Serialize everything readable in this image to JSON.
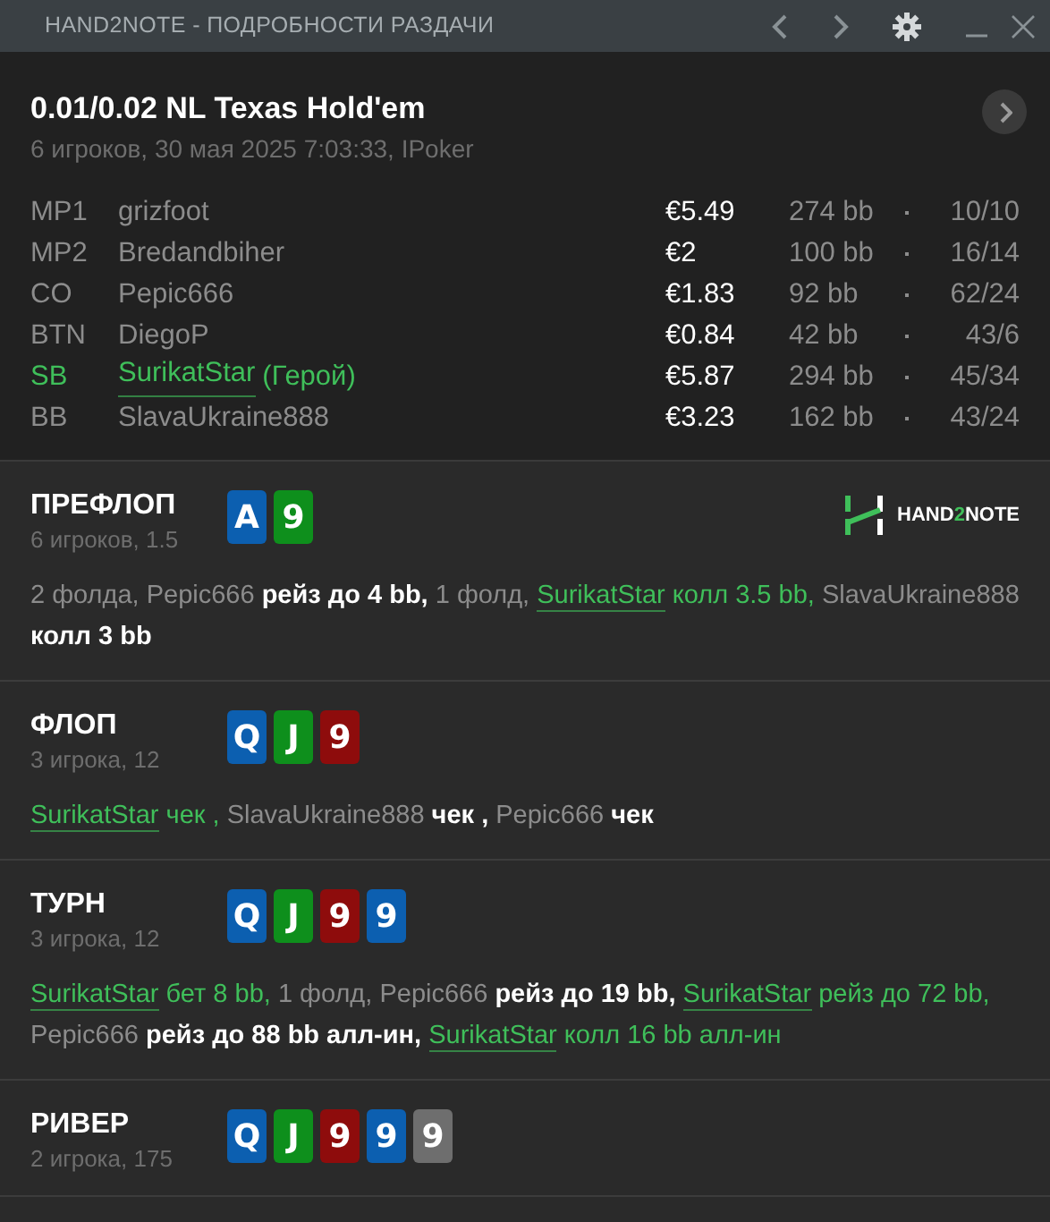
{
  "window": {
    "title": "HAND2NOTE - ПОДРОБНОСТИ РАЗДАЧИ"
  },
  "hand": {
    "title": "0.01/0.02 NL Texas Hold'em",
    "subtitle": "6 игроков, 30 мая 2025 7:03:33, IPoker"
  },
  "players": [
    {
      "position": "MP1",
      "name": "grizfoot",
      "hero": false,
      "stack": "€5.49",
      "bb": "274 bb",
      "stats": "10/10"
    },
    {
      "position": "MP2",
      "name": "Bredandbiher",
      "hero": false,
      "stack": "€2",
      "bb": "100 bb",
      "stats": "16/14"
    },
    {
      "position": "CO",
      "name": "Pepic666",
      "hero": false,
      "stack": "€1.83",
      "bb": "92 bb",
      "stats": "62/24"
    },
    {
      "position": "BTN",
      "name": "DiegoP",
      "hero": false,
      "stack": "€0.84",
      "bb": "42 bb",
      "stats": "43/6"
    },
    {
      "position": "SB",
      "name": "SurikatStar",
      "hero": true,
      "hero_label": "(Герой)",
      "stack": "€5.87",
      "bb": "294 bb",
      "stats": "45/34"
    },
    {
      "position": "BB",
      "name": "SlavaUkraine888",
      "hero": false,
      "stack": "€3.23",
      "bb": "162 bb",
      "stats": "43/24"
    }
  ],
  "logo": {
    "text": "HAND",
    "accent": "2",
    "rest": "NOTE"
  },
  "streets": [
    {
      "name": "ПРЕФЛОП",
      "info": "6 игроков, 1.5",
      "cards": [
        {
          "rank": "A",
          "color": "#0c5fb0"
        },
        {
          "rank": "9",
          "color": "#0e8f1c"
        }
      ],
      "actions": [
        {
          "kind": "fold",
          "text": "2 фолда,"
        },
        {
          "kind": "player",
          "text": "Pepic666",
          "hero": false
        },
        {
          "kind": "action",
          "text": "рейз до 4 bb,",
          "hero": false
        },
        {
          "kind": "fold",
          "text": "1 фолд,"
        },
        {
          "kind": "player",
          "text": "SurikatStar",
          "hero": true
        },
        {
          "kind": "action",
          "text": "колл 3.5 bb,",
          "hero": true
        },
        {
          "kind": "player",
          "text": "SlavaUkraine888",
          "hero": false
        },
        {
          "kind": "action",
          "text": "колл 3 bb",
          "hero": false
        }
      ]
    },
    {
      "name": "ФЛОП",
      "info": "3 игрока, 12",
      "cards": [
        {
          "rank": "Q",
          "color": "#0c5fb0"
        },
        {
          "rank": "J",
          "color": "#0e8f1c"
        },
        {
          "rank": "9",
          "color": "#8e0c0c"
        }
      ],
      "actions": [
        {
          "kind": "player",
          "text": "SurikatStar",
          "hero": true
        },
        {
          "kind": "action",
          "text": "чек ,",
          "hero": true
        },
        {
          "kind": "player",
          "text": "SlavaUkraine888",
          "hero": false
        },
        {
          "kind": "action",
          "text": "чек ,",
          "hero": false
        },
        {
          "kind": "player",
          "text": "Pepic666",
          "hero": false
        },
        {
          "kind": "action",
          "text": "чек",
          "hero": false
        }
      ]
    },
    {
      "name": "ТУРН",
      "info": "3 игрока, 12",
      "cards": [
        {
          "rank": "Q",
          "color": "#0c5fb0"
        },
        {
          "rank": "J",
          "color": "#0e8f1c"
        },
        {
          "rank": "9",
          "color": "#8e0c0c"
        },
        {
          "rank": "9",
          "color": "#0c5fb0"
        }
      ],
      "actions": [
        {
          "kind": "player",
          "text": "SurikatStar",
          "hero": true
        },
        {
          "kind": "action",
          "text": "бет 8 bb,",
          "hero": true
        },
        {
          "kind": "fold",
          "text": "1 фолд,"
        },
        {
          "kind": "player",
          "text": "Pepic666",
          "hero": false
        },
        {
          "kind": "action",
          "text": "рейз до 19 bb,",
          "hero": false
        },
        {
          "kind": "player",
          "text": "SurikatStar",
          "hero": true
        },
        {
          "kind": "action",
          "text": "рейз до 72 bb,",
          "hero": true
        },
        {
          "kind": "player",
          "text": "Pepic666",
          "hero": false
        },
        {
          "kind": "action",
          "text": "рейз до 88 bb алл-ин,",
          "hero": false
        },
        {
          "kind": "player",
          "text": "SurikatStar",
          "hero": true
        },
        {
          "kind": "action",
          "text": "колл 16 bb алл-ин",
          "hero": true
        }
      ]
    },
    {
      "name": "РИВЕР",
      "info": "2 игрока, 175",
      "cards": [
        {
          "rank": "Q",
          "color": "#0c5fb0"
        },
        {
          "rank": "J",
          "color": "#0e8f1c"
        },
        {
          "rank": "9",
          "color": "#8e0c0c"
        },
        {
          "rank": "9",
          "color": "#0c5fb0"
        },
        {
          "rank": "9",
          "color": "#6e6e6e"
        }
      ]
    }
  ]
}
